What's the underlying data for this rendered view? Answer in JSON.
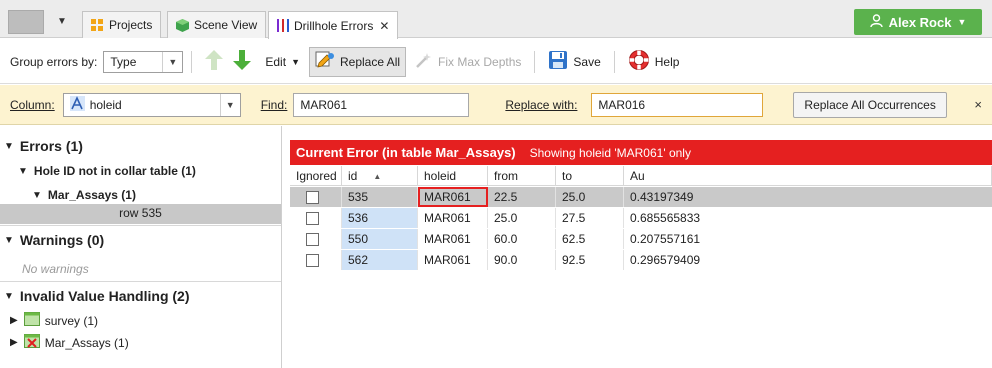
{
  "tabs": [
    {
      "label": "Projects",
      "icon": "grid-icon"
    },
    {
      "label": "Scene View",
      "icon": "cube-icon"
    },
    {
      "label": "Drillhole Errors",
      "icon": "drillhole-icon",
      "close": "✕"
    }
  ],
  "user": {
    "name": "Alex Rock",
    "icon": "user-icon"
  },
  "toolbar": {
    "group_label": "Group errors by:",
    "group_value": "Type",
    "edit_label": "Edit",
    "replace_all_label": "Replace All",
    "fix_max_depths_label": "Fix Max Depths",
    "save_label": "Save",
    "help_label": "Help"
  },
  "findbar": {
    "column_label": "Column:",
    "column_value": "holeid",
    "find_label": "Find:",
    "find_value": "MAR061",
    "replace_label": "Replace with:",
    "replace_value": "MAR016",
    "replace_all_occ_label": "Replace All Occurrences",
    "close": "×"
  },
  "tree": {
    "errors": "Errors (1)",
    "hole_id": "Hole ID not in collar table (1)",
    "mar_assays": "Mar_Assays (1)",
    "row": "row 535",
    "warnings": "Warnings (0)",
    "no_warnings": "No warnings",
    "invalid": "Invalid Value Handling (2)",
    "survey": "survey (1)",
    "mar_assays2": "Mar_Assays (1)"
  },
  "error_bar": {
    "title": "Current Error (in table Mar_Assays)",
    "subtitle": "Showing holeid 'MAR061' only"
  },
  "table": {
    "columns": [
      "Ignored",
      "id",
      "holeid",
      "from",
      "to",
      "Au"
    ],
    "rows": [
      {
        "id": "535",
        "holeid": "MAR061",
        "from": "22.5",
        "to": "25.0",
        "au": "0.43197349"
      },
      {
        "id": "536",
        "holeid": "MAR061",
        "from": "25.0",
        "to": "27.5",
        "au": "0.685565833"
      },
      {
        "id": "550",
        "holeid": "MAR061",
        "from": "60.0",
        "to": "62.5",
        "au": "0.207557161"
      },
      {
        "id": "562",
        "holeid": "MAR061",
        "from": "90.0",
        "to": "92.5",
        "au": "0.296579409"
      }
    ]
  },
  "colors": {
    "accent_red": "#e52020",
    "user_green": "#5bb24d",
    "findbar_bg": "#fdf3d0"
  }
}
